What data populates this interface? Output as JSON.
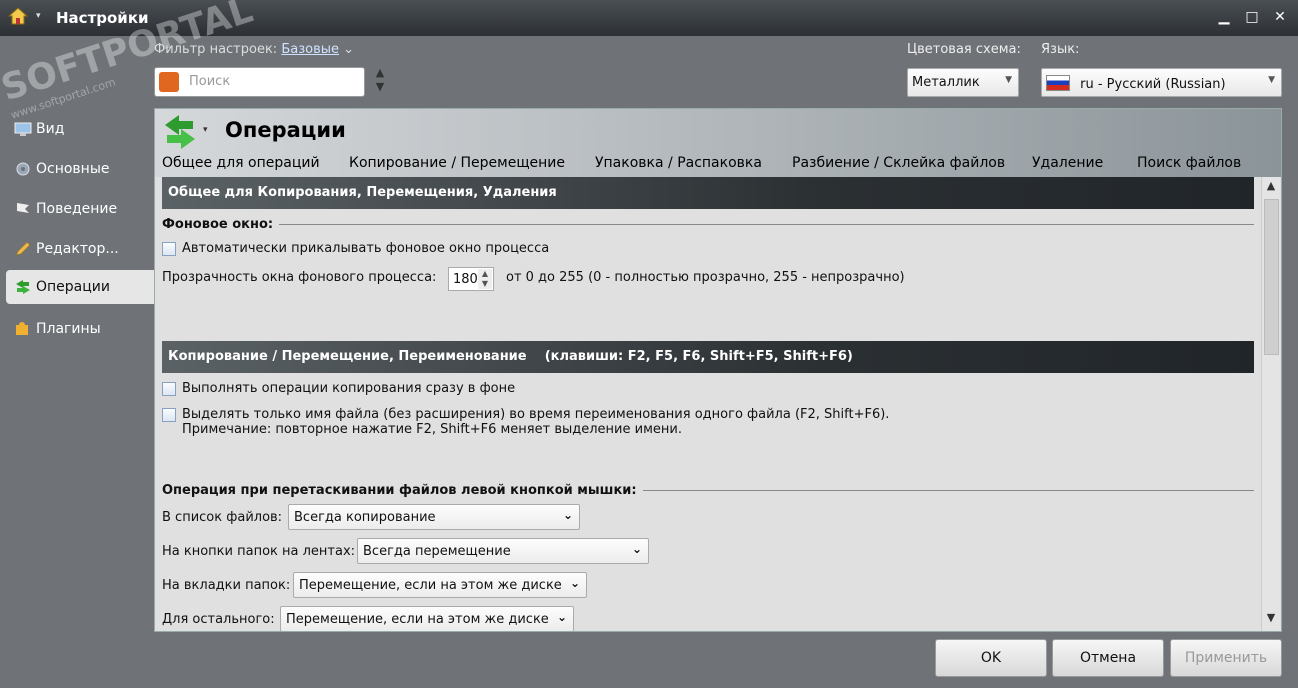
{
  "window": {
    "title": "Настройки",
    "menu_caret": "▾",
    "minimize": "▁",
    "maximize": "□",
    "close": "✕"
  },
  "top": {
    "filter_label": "Фильтр настроек:",
    "filter_value": "Базовые",
    "filter_caret": "⌄",
    "search_placeholder": "Поиск",
    "color_scheme_label": "Цветовая схема:",
    "color_scheme_value": "Металлик",
    "language_label": "Язык:",
    "language_value": "ru - Русский (Russian)"
  },
  "watermark": {
    "text": "SOFTPORTAL",
    "sub": "www.softportal.com",
    "tm": "™"
  },
  "sidebar": {
    "items": [
      {
        "label": "Вид",
        "icon": "monitor-icon"
      },
      {
        "label": "Основные",
        "icon": "gear-icon"
      },
      {
        "label": "Поведение",
        "icon": "flag-icon"
      },
      {
        "label": "Редактор...",
        "icon": "pencil-icon"
      },
      {
        "label": "Операции",
        "icon": "swap-arrows-icon",
        "active": true
      },
      {
        "label": "Плагины",
        "icon": "puzzle-icon"
      }
    ]
  },
  "panel": {
    "title": "Операции",
    "caret": "▾",
    "tabs": [
      "Общее для операций",
      "Копирование / Перемещение",
      "Упаковка / Распаковка",
      "Разбиение / Склейка файлов",
      "Удаление",
      "Поиск файлов"
    ],
    "section1": "Общее для Копирования, Перемещения, Удаления",
    "background_window_header": "Фоновое окно:",
    "auto_pin_label": "Автоматически прикалывать фоновое окно процесса",
    "transparency_label": "Прозрачность окна фонового процесса:",
    "transparency_value": "180",
    "transparency_hint": "от 0 до 255 (0 - полностью прозрачно, 255 - непрозрачно)",
    "section2": "Копирование / Перемещение, Переименование",
    "section2_keys": "(клавиши: F2, F5, F6, Shift+F5, Shift+F6)",
    "bg_copy_label": "Выполнять операции копирования сразу в фоне",
    "select_name_label": "Выделять только имя файла (без расширения) во время переименования одного файла (F2, Shift+F6).",
    "select_name_note": "Примечание: повторное нажатие F2, Shift+F6 меняет выделение имени.",
    "drag_header": "Операция при перетаскивании файлов левой кнопкой мышки:",
    "drag_rows": [
      {
        "label": "В список файлов:",
        "value": "Всегда копирование"
      },
      {
        "label": "На кнопки папок на лентах:",
        "value": "Всегда перемещение"
      },
      {
        "label": "На вкладки папок:",
        "value": "Перемещение, если на этом же диске"
      },
      {
        "label": "Для остального:",
        "value": "Перемещение, если на этом же диске"
      }
    ]
  },
  "buttons": {
    "ok": "OK",
    "cancel": "Отмена",
    "apply": "Применить"
  },
  "colors": {
    "chrome": "#6f7378",
    "panel": "#e0e0e0",
    "section": "#2b3033"
  }
}
